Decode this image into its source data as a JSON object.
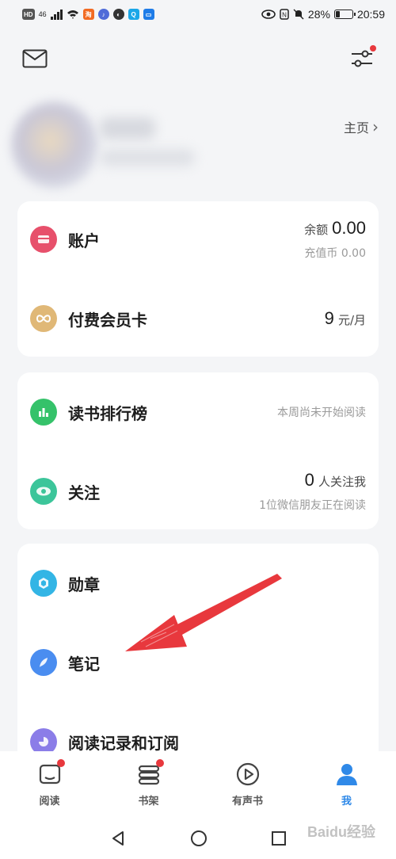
{
  "status_bar": {
    "left_chips": [
      "HD",
      "46",
      "淘"
    ],
    "battery": "28%",
    "time": "20:59",
    "battery_level": 0.28
  },
  "header": {
    "mail_icon": "mail-icon",
    "settings_icon": "filter-sliders-icon",
    "settings_badge": true
  },
  "profile": {
    "homepage_label": "主页",
    "homepage_chevron": "›"
  },
  "account_card": {
    "account": {
      "label": "账户",
      "balance_label": "余额",
      "balance_value": "0.00",
      "recharge_text": "充值币 0.00",
      "icon": "wallet-icon",
      "color": "#e7506b"
    },
    "membership": {
      "label": "付费会员卡",
      "price_value": "9",
      "price_unit": "元/月",
      "icon": "infinity-icon",
      "color": "#e0b877"
    }
  },
  "social_card": {
    "ranking": {
      "label": "读书排行榜",
      "status": "本周尚未开始阅读",
      "icon": "bar-chart-icon",
      "color": "#35c26a"
    },
    "follow": {
      "label": "关注",
      "count": "0",
      "count_suffix": "人关注我",
      "friends_text": "1位微信朋友正在阅读",
      "icon": "eye-icon",
      "color": "#3cc59a"
    }
  },
  "misc_card": {
    "medal": {
      "label": "勋章",
      "icon": "medal-icon",
      "color": "#33b5e5"
    },
    "notes": {
      "label": "笔记",
      "icon": "feather-icon",
      "color": "#4a8df0"
    },
    "history": {
      "label": "阅读记录和订阅",
      "icon": "history-icon",
      "color": "#8b7de8"
    }
  },
  "bottom_nav": [
    {
      "label": "阅读",
      "icon": "book-open-icon",
      "badge": true,
      "active": false
    },
    {
      "label": "书架",
      "icon": "bookshelf-icon",
      "badge": true,
      "active": false
    },
    {
      "label": "有声书",
      "icon": "play-circle-icon",
      "badge": false,
      "active": false
    },
    {
      "label": "我",
      "icon": "person-icon",
      "badge": false,
      "active": true
    }
  ],
  "colors": {
    "accent": "#2f89e8",
    "badge": "#e8383d",
    "arrow": "#e8383d"
  },
  "watermark": "Baidu经验"
}
